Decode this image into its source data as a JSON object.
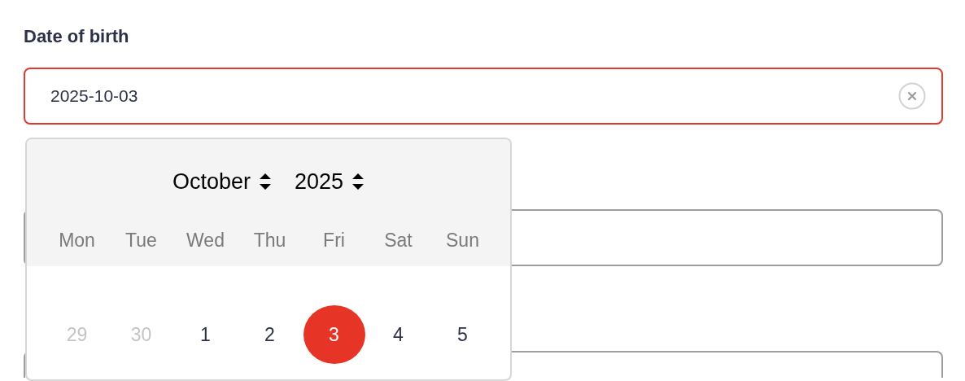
{
  "field": {
    "label": "Date of birth",
    "value": "2025-10-03",
    "invalid": true
  },
  "calendar": {
    "month": "October",
    "year": "2025",
    "weekdays": [
      "Mon",
      "Tue",
      "Wed",
      "Thu",
      "Fri",
      "Sat",
      "Sun"
    ],
    "days": [
      {
        "label": "29",
        "outside": true,
        "selected": false
      },
      {
        "label": "30",
        "outside": true,
        "selected": false
      },
      {
        "label": "1",
        "outside": false,
        "selected": false
      },
      {
        "label": "2",
        "outside": false,
        "selected": false
      },
      {
        "label": "3",
        "outside": false,
        "selected": true
      },
      {
        "label": "4",
        "outside": false,
        "selected": false
      },
      {
        "label": "5",
        "outside": false,
        "selected": false
      }
    ]
  }
}
